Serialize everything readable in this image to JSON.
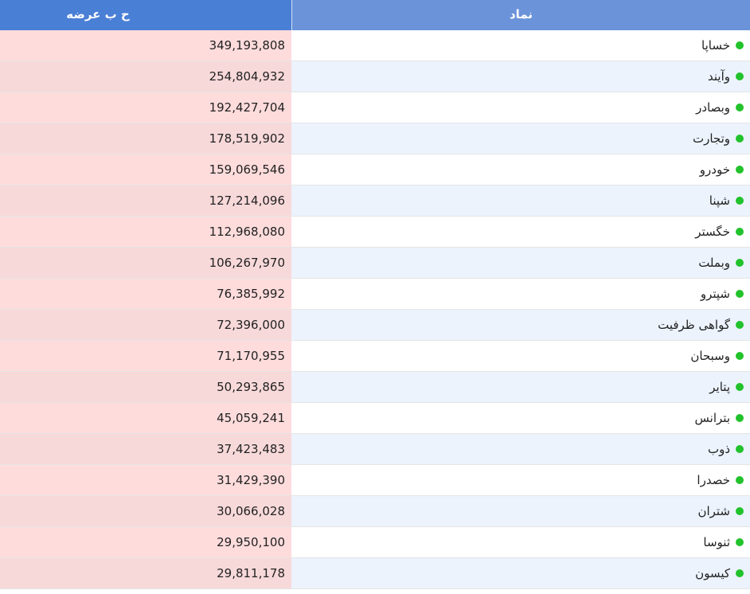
{
  "header": {
    "value_label": "ح ب عرضه",
    "symbol_label": "نماد"
  },
  "status_color": "#22c22c",
  "rows": [
    {
      "symbol": "خساپا",
      "value": "349,193,808"
    },
    {
      "symbol": "وآیند",
      "value": "254,804,932"
    },
    {
      "symbol": "وبصادر",
      "value": "192,427,704"
    },
    {
      "symbol": "وتجارت",
      "value": "178,519,902"
    },
    {
      "symbol": "خودرو",
      "value": "159,069,546"
    },
    {
      "symbol": "شپنا",
      "value": "127,214,096"
    },
    {
      "symbol": "خگستر",
      "value": "112,968,080"
    },
    {
      "symbol": "وبملت",
      "value": "106,267,970"
    },
    {
      "symbol": "شپترو",
      "value": "76,385,992"
    },
    {
      "symbol": "گواهی ظرفیت",
      "value": "72,396,000"
    },
    {
      "symbol": "وسبحان",
      "value": "71,170,955"
    },
    {
      "symbol": "پتایر",
      "value": "50,293,865"
    },
    {
      "symbol": "بترانس",
      "value": "45,059,241"
    },
    {
      "symbol": "ذوب",
      "value": "37,423,483"
    },
    {
      "symbol": "خصدرا",
      "value": "31,429,390"
    },
    {
      "symbol": "شتران",
      "value": "30,066,028"
    },
    {
      "symbol": "ثنوسا",
      "value": "29,950,100"
    },
    {
      "symbol": "کیسون",
      "value": "29,811,178"
    }
  ]
}
